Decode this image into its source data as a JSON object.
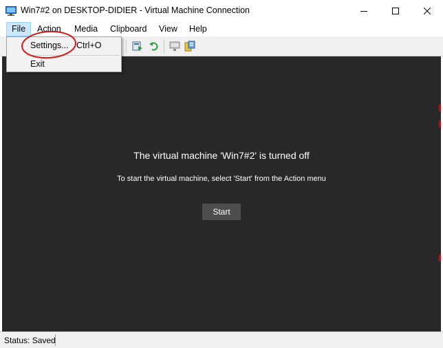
{
  "window": {
    "title": "Win7#2 on DESKTOP-DIDIER - Virtual Machine Connection",
    "controls": [
      "minimize",
      "maximize",
      "close"
    ]
  },
  "menubar": {
    "items": [
      {
        "label": "File",
        "active": true
      },
      {
        "label": "Action"
      },
      {
        "label": "Media"
      },
      {
        "label": "Clipboard"
      },
      {
        "label": "View"
      },
      {
        "label": "Help"
      }
    ]
  },
  "file_menu": {
    "items": [
      {
        "label": "Settings...",
        "shortcut": "Ctrl+O"
      },
      {
        "label": "Exit"
      }
    ]
  },
  "toolbar": {
    "icons": [
      "reset-icon",
      "revert-icon",
      "enhanced-session-icon",
      "share-icon"
    ]
  },
  "vm": {
    "heading": "The virtual machine 'Win7#2' is turned off",
    "hint": "To start the virtual machine, select 'Start' from the Action menu",
    "start_label": "Start"
  },
  "status": {
    "text": "Status: Saved"
  },
  "colors": {
    "screen_bg": "#282828",
    "annotation": "#d11a1a",
    "menu_highlight": "#cce8ff"
  }
}
